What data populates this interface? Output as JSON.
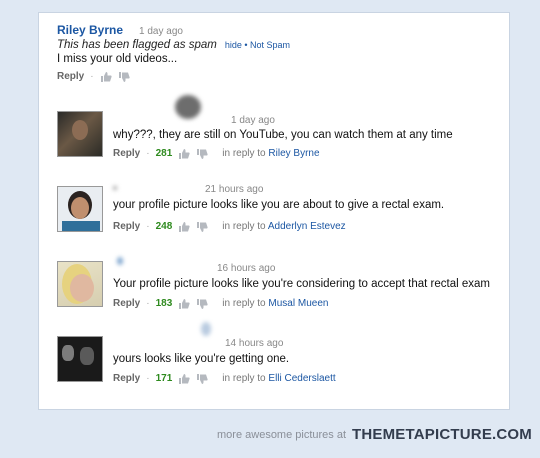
{
  "comments": [
    {
      "author": "Riley Byrne",
      "time": "1 day ago",
      "flag_text": "This has been flagged as spam",
      "flag_links": "hide • Not Spam",
      "text": "I miss your old videos...",
      "reply_label": "Reply"
    },
    {
      "time": "1 day ago",
      "text": "why???, they are still on YouTube, you can watch them at any time",
      "reply_label": "Reply",
      "likes": "281",
      "in_reply_to_prefix": "in reply to",
      "in_reply_to": "Riley Byrne"
    },
    {
      "time": "21 hours ago",
      "text": "your profile picture looks like you are about to give a rectal exam.",
      "reply_label": "Reply",
      "likes": "248",
      "in_reply_to_prefix": "in reply to",
      "in_reply_to": "Adderlyn Estevez"
    },
    {
      "time": "16 hours ago",
      "text": "Your profile picture looks like you're considering to accept that rectal exam",
      "reply_label": "Reply",
      "likes": "183",
      "in_reply_to_prefix": "in reply to",
      "in_reply_to": "Musal Mueen"
    },
    {
      "time": "14 hours ago",
      "text": "yours looks like you're getting one.",
      "reply_label": "Reply",
      "likes": "171",
      "in_reply_to_prefix": "in reply to",
      "in_reply_to": "Elli Cederslaett"
    }
  ],
  "footer": {
    "text": "more awesome pictures at",
    "brand": "THEMETAPICTURE.COM"
  },
  "colors": {
    "link": "#1c57a3",
    "likes": "#2e8a1e",
    "background": "#dfe8f3"
  }
}
